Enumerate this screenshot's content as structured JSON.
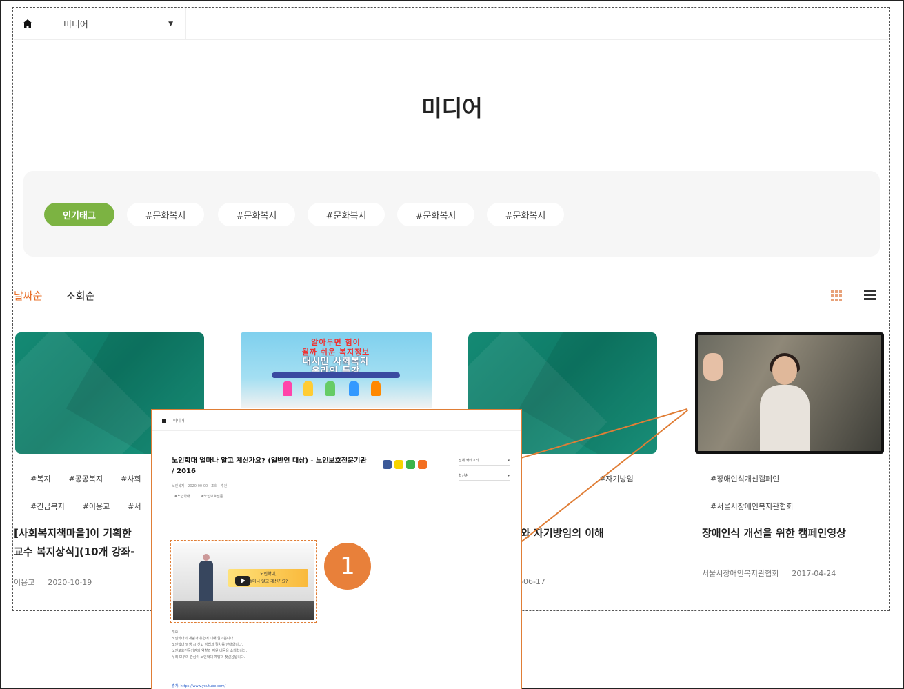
{
  "nav": {
    "dropdown_label": "미디어"
  },
  "page": {
    "title": "미디어"
  },
  "tags": {
    "popular_label": "인기태그",
    "items": [
      "#문화복지",
      "#문화복지",
      "#문화복지",
      "#문화복지",
      "#문화복지"
    ]
  },
  "sort": {
    "date_label": "날짜순",
    "views_label": "조회순"
  },
  "cards": [
    {
      "tags_row1": [
        "#복지",
        "#공공복지",
        "#사회"
      ],
      "tags_row2": [
        "#긴급복지",
        "#이용교",
        "#서"
      ],
      "title_line1": "[사회복지책마을]이 기획한",
      "title_line2": "교수 복지상식](10개 강좌- ",
      "author": "이용교",
      "date": "2020-10-19"
    },
    {
      "poster_line1": "알아두면 힘이",
      "poster_line2": "될까 쉬운 복지정보",
      "poster_line3": "대시민 사회복지",
      "poster_line4": "온라인 특강"
    },
    {
      "tags_row1": [
        "#자기방임"
      ],
      "title_line1": "와 자기방임의 이해",
      "date": "-06-17"
    },
    {
      "tags_row1": [
        "#장애인식개선캠페인"
      ],
      "tags_row2": [
        "#서울시장애인복지관협회"
      ],
      "title_line1": "장애인식 개선을 위한 캠페인영상",
      "author": "서울시장애인복지관협회",
      "date": "2017-04-24"
    }
  ],
  "zoom": {
    "nav_label": "미디어",
    "title": "노인학대 얼마나 알고 계신가요? (일반인 대상) - 노인보호전문기관 / 2016",
    "meta": "노인복지 · 2020-00-00 · 조회 · 추천",
    "tags": [
      "#노인학대",
      "#노인보호전문"
    ],
    "side_select1": "전체 카테고리",
    "side_select2": "최신순",
    "banner_line1": "노인학대,",
    "banner_line2": "얼마나 알고 계신가요?",
    "text_lines": [
      "개요",
      "노인학대의 개념과 유형에 대해 알아봅니다.",
      "노인학대 발생 시 신고 방법과 절차를 안내합니다.",
      "노인보호전문기관의 역할과 지원 내용을 소개합니다.",
      "우리 모두의 관심이 노인학대 예방의 첫걸음입니다."
    ],
    "link": "출처: https://www.youtube.com/"
  },
  "badge": {
    "number": "1"
  },
  "colors": {
    "accent": "#e8702a",
    "popular_tag": "#7cb342",
    "highlight": "#e07e36"
  }
}
